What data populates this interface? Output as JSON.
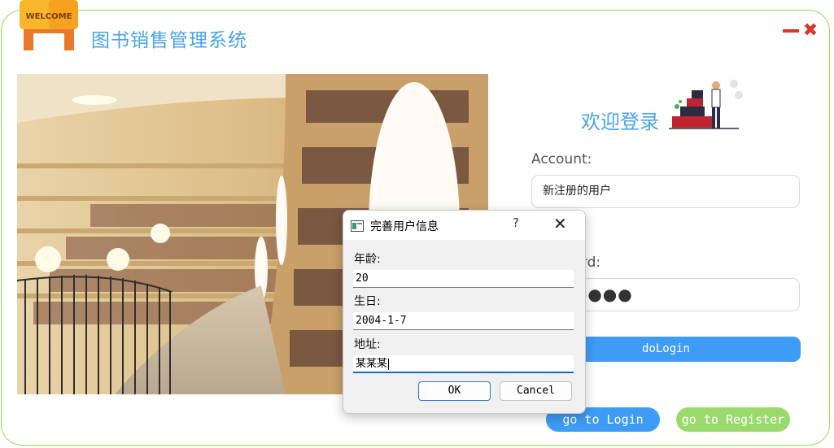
{
  "app": {
    "logo_text": "WELCOME",
    "title": "图书销售管理系统"
  },
  "login": {
    "welcome": "欢迎登录",
    "account_label": "Account:",
    "account_value": "新注册的用户",
    "password_label": "Password:",
    "password_mask": "●●●●●●",
    "login_button": "doLogin",
    "go_login": "go to Login",
    "go_register": "go to Register"
  },
  "dialog": {
    "title": "完善用户信息",
    "help": "?",
    "close": "✕",
    "age_label": "年龄:",
    "age_value": "20",
    "birthday_label": "生日:",
    "birthday_value": "2004-1-7",
    "address_label": "地址:",
    "address_value": "某某某",
    "ok": "OK",
    "cancel": "Cancel"
  },
  "colors": {
    "accent_blue": "#3f9cf6",
    "accent_green": "#9ad96c",
    "title_blue": "#4aa3e8",
    "window_close": "#d9362c"
  }
}
